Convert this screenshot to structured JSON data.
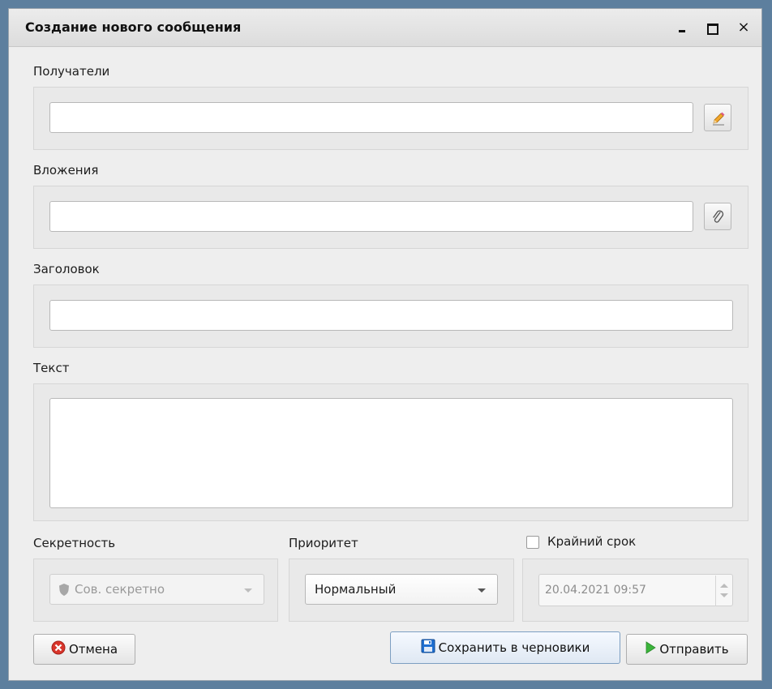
{
  "window": {
    "title": "Создание нового сообщения",
    "controls": {
      "minimize": "_",
      "maximize": "□",
      "close": "×"
    }
  },
  "recipients": {
    "label": "Получатели",
    "value": "",
    "button_icon": "pencil-icon"
  },
  "attachments": {
    "label": "Вложения",
    "value": "",
    "button_icon": "paperclip-icon"
  },
  "subject": {
    "label": "Заголовок",
    "value": ""
  },
  "body": {
    "label": "Текст",
    "value": ""
  },
  "secrecy": {
    "label": "Секретность",
    "selected": "Сов. секретно",
    "disabled": true,
    "icon": "shield-icon"
  },
  "priority": {
    "label": "Приоритет",
    "selected": "Нормальный"
  },
  "deadline": {
    "label": "Крайний срок",
    "checked": false,
    "value": "20.04.2021 09:57",
    "disabled": true
  },
  "buttons": {
    "cancel": "Отмена",
    "save_draft": "Сохранить в черновики",
    "send": "Отправить"
  },
  "colors": {
    "cancel_icon": "#d9352b",
    "save_icon": "#1f6fd1",
    "send_icon": "#3bb43b"
  }
}
